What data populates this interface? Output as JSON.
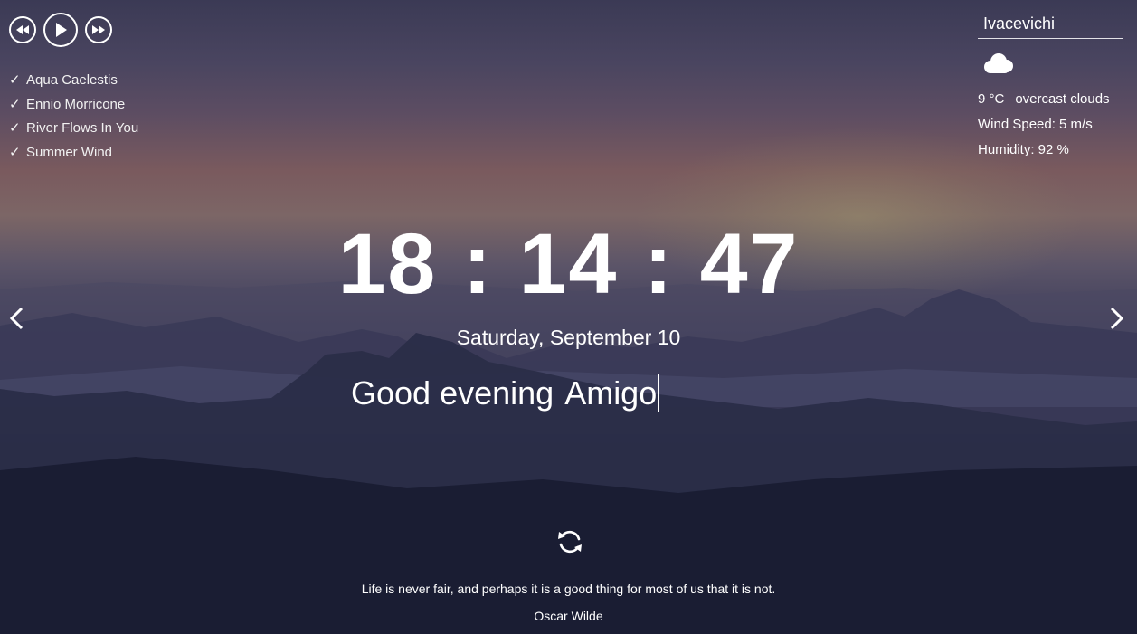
{
  "player": {
    "prev_icon": "rewind-icon",
    "play_icon": "play-icon",
    "next_icon": "fast-forward-icon"
  },
  "playlist": [
    {
      "check": "✓",
      "title": "Aqua Caelestis"
    },
    {
      "check": "✓",
      "title": "Ennio Morricone"
    },
    {
      "check": "✓",
      "title": "River Flows In You"
    },
    {
      "check": "✓",
      "title": "Summer Wind"
    }
  ],
  "weather": {
    "city": "Ivacevichi",
    "icon": "cloud-icon",
    "temperature": "9 °C",
    "description": "overcast clouds",
    "wind": "Wind Speed: 5 m/s",
    "humidity": "Humidity: 92 %"
  },
  "clock": {
    "time": "18 : 14 : 47",
    "date": "Saturday, September 10"
  },
  "greeting": {
    "text": "Good evening",
    "name": "Amigo"
  },
  "slider": {
    "prev_icon": "chevron-left-icon",
    "next_icon": "chevron-right-icon"
  },
  "quote": {
    "refresh_icon": "refresh-icon",
    "text": "Life is never fair, and perhaps it is a good thing for most of us that it is not.",
    "author": "Oscar Wilde"
  },
  "colors": {
    "text": "#ffffff",
    "sky_top": "#3b3a55",
    "sky_glow": "#7a5a5e",
    "ground": "#171a30"
  }
}
